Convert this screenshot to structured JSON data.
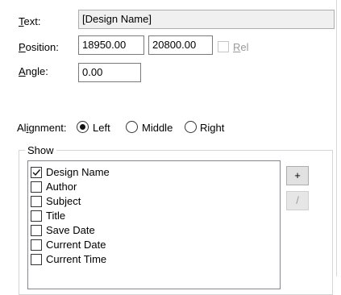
{
  "text_field": {
    "label": "Text:",
    "value": "[Design Name]"
  },
  "position": {
    "label": "Position:",
    "x": "18950.00",
    "y": "20800.00",
    "rel_label": "Rel",
    "rel_checked": false
  },
  "angle": {
    "label": "Angle:",
    "value": "0.00"
  },
  "alignment": {
    "label": "Alignment:",
    "options": [
      "Left",
      "Middle",
      "Right"
    ],
    "selected": "Left"
  },
  "show": {
    "title": "Show",
    "items": [
      {
        "label": "Design Name",
        "checked": true
      },
      {
        "label": "Author",
        "checked": false
      },
      {
        "label": "Subject",
        "checked": false
      },
      {
        "label": "Title",
        "checked": false
      },
      {
        "label": "Save Date",
        "checked": false
      },
      {
        "label": "Current Date",
        "checked": false
      },
      {
        "label": "Current Time",
        "checked": false
      }
    ],
    "add_label": "+",
    "edit_label": "/"
  }
}
